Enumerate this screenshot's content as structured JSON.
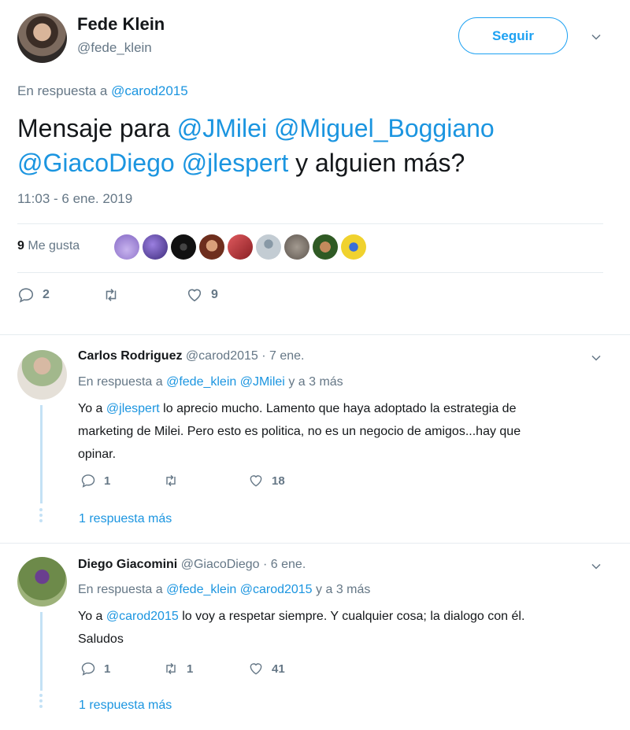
{
  "tweet": {
    "author_name": "Fede Klein",
    "author_handle": "@fede_klein",
    "follow_label": "Seguir",
    "reply_prefix": "En respuesta a",
    "reply_to": "@carod2015",
    "text_parts": [
      "Mensaje para ",
      "@JMilei",
      " ",
      "@Miguel_Boggiano",
      " ",
      "@GiacoDiego",
      " ",
      "@jlespert",
      " y alguien más?"
    ],
    "timestamp": "11:03 - 6 ene. 2019",
    "likes_number": "9",
    "likes_label": "Me gusta",
    "liker_colors": [
      "#a78bd8",
      "#6b4fb0",
      "#1a1a1a",
      "#b0513a",
      "#c9474e",
      "#b8c4cc",
      "#8b8580",
      "#4a7a3a",
      "#e0c12a"
    ],
    "replies_count": "2",
    "retweets_count": "",
    "likes_action_count": "9"
  },
  "replies": [
    {
      "name": "Carlos Rodriguez",
      "handle": "@carod2015",
      "time": "· 7 ene.",
      "reply_prefix": "En respuesta a",
      "reply_links": [
        "@fede_klein",
        "@JMilei"
      ],
      "reply_suffix": "y a 3 más",
      "text_line1_pre": "Yo a ",
      "text_line1_link": "@jlespert",
      "text_line1_post": " lo aprecio mucho. Lamento que haya adoptado la estrategia de",
      "text_line2": "marketing de Milei. Pero esto es politica, no es un negocio de amigos...hay que",
      "text_line3": "opinar.",
      "replies_count": "1",
      "retweets_count": "",
      "likes_count": "18",
      "more_replies": "1 respuesta más"
    },
    {
      "name": "Diego Giacomini",
      "handle": "@GiacoDiego",
      "time": "· 6 ene.",
      "reply_prefix": "En respuesta a",
      "reply_links": [
        "@fede_klein",
        "@carod2015"
      ],
      "reply_suffix": "y a 3 más",
      "text_line1_pre": "Yo a ",
      "text_line1_link": "@carod2015",
      "text_line1_post": " lo voy a respetar siempre. Y cualquier cosa; la dialogo con él.",
      "text_line2": "Saludos",
      "replies_count": "1",
      "retweets_count": "1",
      "likes_count": "41",
      "more_replies": "1 respuesta más"
    }
  ],
  "colors": {
    "link": "#1b95e0",
    "muted": "#657786",
    "accent": "#1da1f2",
    "thread": "#c4e1f5"
  }
}
